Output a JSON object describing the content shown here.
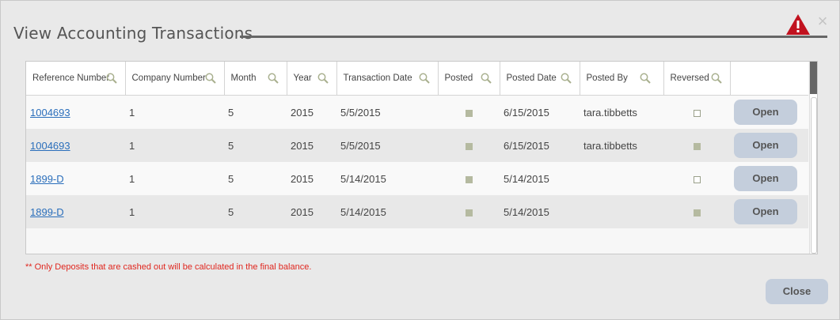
{
  "dialog": {
    "title": "View Accounting Transactions",
    "close_symbol": "×",
    "warning_icon": "warning-triangle-icon",
    "close_icon": "close-icon"
  },
  "grid": {
    "columns": [
      {
        "label": "Reference Number",
        "search_icon": "search-icon"
      },
      {
        "label": "Company Number",
        "search_icon": "search-icon"
      },
      {
        "label": "Month",
        "search_icon": "search-icon"
      },
      {
        "label": "Year",
        "search_icon": "search-icon"
      },
      {
        "label": "Transaction Date",
        "search_icon": "search-icon"
      },
      {
        "label": "Posted",
        "search_icon": "search-icon"
      },
      {
        "label": "Posted Date",
        "search_icon": "search-icon"
      },
      {
        "label": "Posted By",
        "search_icon": "search-icon"
      },
      {
        "label": "Reversed",
        "search_icon": "search-icon"
      },
      {
        "label": ""
      }
    ],
    "rows": [
      {
        "ref": "1004693",
        "company": "1",
        "month": "5",
        "year": "2015",
        "tdate": "5/5/2015",
        "posted": true,
        "pdate": "6/15/2015",
        "pby": "tara.tibbetts",
        "reversed": false,
        "action": "Open"
      },
      {
        "ref": "1004693",
        "company": "1",
        "month": "5",
        "year": "2015",
        "tdate": "5/5/2015",
        "posted": true,
        "pdate": "6/15/2015",
        "pby": "tara.tibbetts",
        "reversed": true,
        "action": "Open"
      },
      {
        "ref": "1899-D",
        "company": "1",
        "month": "5",
        "year": "2015",
        "tdate": "5/14/2015",
        "posted": true,
        "pdate": "5/14/2015",
        "pby": "",
        "reversed": false,
        "action": "Open"
      },
      {
        "ref": "1899-D",
        "company": "1",
        "month": "5",
        "year": "2015",
        "tdate": "5/14/2015",
        "posted": true,
        "pdate": "5/14/2015",
        "pby": "",
        "reversed": true,
        "action": "Open"
      }
    ]
  },
  "footer": {
    "note": "** Only Deposits that are cashed out will be calculated in the final balance.",
    "close_label": "Close"
  },
  "colors": {
    "link": "#2a6ebb",
    "note": "#e0261e",
    "button": "#c4cedc",
    "checked": "#b5baa0",
    "warning": "#c1121f"
  }
}
